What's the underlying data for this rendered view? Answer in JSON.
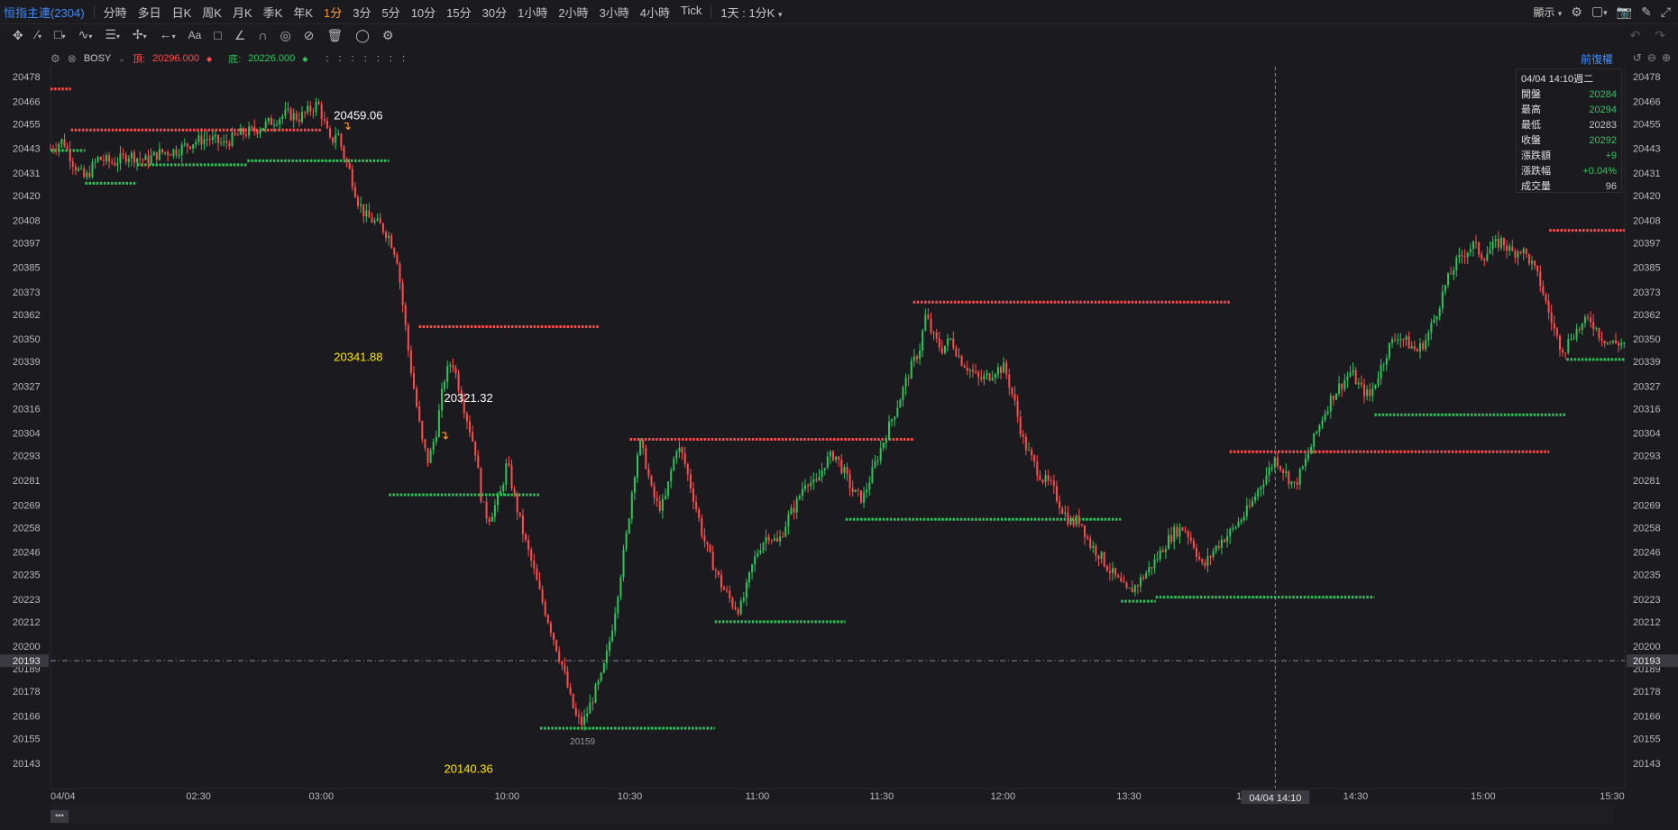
{
  "toolbar": {
    "symbol": "恒指主連(2304)",
    "timeframes": [
      "分時",
      "多日",
      "日K",
      "周K",
      "月K",
      "季K",
      "年K",
      "1分",
      "3分",
      "5分",
      "10分",
      "15分",
      "30分",
      "1小時",
      "2小時",
      "3小時",
      "4小時",
      "Tick"
    ],
    "active_timeframe": "1分",
    "interval_select": "1天 : 1分K",
    "display_label": "顯示",
    "icons": [
      "chevron-down-icon",
      "gear-icon",
      "window-icon",
      "camera-icon",
      "brush-icon",
      "expand-icon"
    ]
  },
  "drawbar": {
    "icons": [
      "crosshair-icon",
      "trendline-icon",
      "rectangle-icon",
      "polyline-icon",
      "fib-icon",
      "measure-icon",
      "arrow-icon",
      "text-icon",
      "comment-icon",
      "ruler-icon",
      "magnet-icon",
      "lock-icon",
      "hide-icon",
      "delete-icon",
      "link-icon",
      "settings-icon"
    ],
    "right_icons": [
      "undo-icon",
      "redo-icon"
    ]
  },
  "legend": {
    "name": "BOSY",
    "top_label": "頂:",
    "top_value": "20296.000",
    "bottom_label": "底:",
    "bottom_value": "20226.000",
    "placeholders": ":   :   :   :   :   :   :",
    "adjust_label": "前復權"
  },
  "infobox": {
    "datetime": "04/04 14:10週二",
    "rows": [
      {
        "label": "開盤",
        "value": "20284",
        "color": "up"
      },
      {
        "label": "最高",
        "value": "20294",
        "color": "up"
      },
      {
        "label": "最低",
        "value": "20283",
        "color": "neutral"
      },
      {
        "label": "收盤",
        "value": "20292",
        "color": "up"
      },
      {
        "label": "漲跌額",
        "value": "+9",
        "color": "up"
      },
      {
        "label": "漲跌幅",
        "value": "+0.04%",
        "color": "up"
      },
      {
        "label": "成交量",
        "value": "96",
        "color": "neutral"
      }
    ]
  },
  "colors": {
    "background": "#1b1b1f",
    "up": "#30c35a",
    "down": "#ff4d4d",
    "accent": "#3f8cff",
    "active": "#ff9a2e",
    "annotation": "#ffe600",
    "annotation_white": "#ffffff",
    "grid": "#28282c"
  },
  "chart_data": {
    "type": "candlestick",
    "symbol": "恒指主連(2304)",
    "interval": "1分",
    "y_axis_ticks": [
      20478,
      20466,
      20455,
      20443,
      20431,
      20420,
      20408,
      20397,
      20385,
      20373,
      20362,
      20350,
      20339,
      20327,
      20316,
      20304,
      20293,
      20281,
      20269,
      20258,
      20246,
      20235,
      20223,
      20212,
      20200,
      20189,
      20178,
      20166,
      20155,
      20143
    ],
    "y_range": [
      20135,
      20482
    ],
    "x_axis_labels": [
      "04/04",
      "02:30",
      "03:00",
      "10:00",
      "10:30",
      "11:00",
      "11:30",
      "12:00",
      "13:30",
      "1",
      "14:30",
      "15:00",
      "15:30"
    ],
    "x_range": [
      0,
      1000
    ],
    "x_axis_label_positions": [
      0,
      94,
      172,
      290,
      368,
      449,
      528,
      605,
      685,
      755,
      829,
      910,
      992
    ],
    "current_price": "20193",
    "crosshair_label": "04/04 14:10",
    "crosshair_x": 778,
    "price_path": [
      [
        0,
        20443
      ],
      [
        8,
        20447
      ],
      [
        15,
        20435
      ],
      [
        22,
        20428
      ],
      [
        30,
        20438
      ],
      [
        40,
        20436
      ],
      [
        50,
        20440
      ],
      [
        60,
        20437
      ],
      [
        70,
        20441
      ],
      [
        80,
        20442
      ],
      [
        90,
        20446
      ],
      [
        100,
        20448
      ],
      [
        110,
        20445
      ],
      [
        120,
        20450
      ],
      [
        130,
        20452
      ],
      [
        140,
        20456
      ],
      [
        150,
        20460
      ],
      [
        158,
        20458
      ],
      [
        165,
        20462
      ],
      [
        170,
        20465
      ],
      [
        174,
        20455
      ],
      [
        178,
        20445
      ],
      [
        182,
        20452
      ],
      [
        186,
        20440
      ],
      [
        190,
        20432
      ],
      [
        195,
        20418
      ],
      [
        200,
        20410
      ],
      [
        210,
        20405
      ],
      [
        215,
        20400
      ],
      [
        220,
        20390
      ],
      [
        224,
        20365
      ],
      [
        228,
        20340
      ],
      [
        232,
        20320
      ],
      [
        236,
        20300
      ],
      [
        240,
        20290
      ],
      [
        245,
        20305
      ],
      [
        250,
        20330
      ],
      [
        255,
        20340
      ],
      [
        260,
        20325
      ],
      [
        265,
        20310
      ],
      [
        270,
        20295
      ],
      [
        274,
        20270
      ],
      [
        278,
        20262
      ],
      [
        282,
        20268
      ],
      [
        286,
        20275
      ],
      [
        290,
        20290
      ],
      [
        294,
        20275
      ],
      [
        298,
        20262
      ],
      [
        302,
        20250
      ],
      [
        306,
        20240
      ],
      [
        310,
        20228
      ],
      [
        314,
        20218
      ],
      [
        318,
        20208
      ],
      [
        322,
        20198
      ],
      [
        326,
        20188
      ],
      [
        330,
        20175
      ],
      [
        334,
        20165
      ],
      [
        338,
        20162
      ],
      [
        342,
        20170
      ],
      [
        346,
        20178
      ],
      [
        350,
        20185
      ],
      [
        354,
        20198
      ],
      [
        358,
        20215
      ],
      [
        362,
        20235
      ],
      [
        366,
        20255
      ],
      [
        370,
        20280
      ],
      [
        374,
        20300
      ],
      [
        378,
        20290
      ],
      [
        382,
        20275
      ],
      [
        386,
        20268
      ],
      [
        390,
        20270
      ],
      [
        394,
        20285
      ],
      [
        398,
        20298
      ],
      [
        402,
        20292
      ],
      [
        406,
        20280
      ],
      [
        410,
        20268
      ],
      [
        414,
        20255
      ],
      [
        418,
        20245
      ],
      [
        422,
        20238
      ],
      [
        426,
        20230
      ],
      [
        430,
        20225
      ],
      [
        434,
        20220
      ],
      [
        438,
        20218
      ],
      [
        442,
        20228
      ],
      [
        446,
        20240
      ],
      [
        450,
        20248
      ],
      [
        456,
        20255
      ],
      [
        462,
        20250
      ],
      [
        468,
        20262
      ],
      [
        474,
        20270
      ],
      [
        480,
        20282
      ],
      [
        486,
        20278
      ],
      [
        492,
        20290
      ],
      [
        498,
        20294
      ],
      [
        504,
        20285
      ],
      [
        510,
        20275
      ],
      [
        516,
        20272
      ],
      [
        522,
        20285
      ],
      [
        528,
        20298
      ],
      [
        534,
        20310
      ],
      [
        540,
        20322
      ],
      [
        546,
        20335
      ],
      [
        552,
        20345
      ],
      [
        556,
        20362
      ],
      [
        560,
        20352
      ],
      [
        566,
        20345
      ],
      [
        572,
        20350
      ],
      [
        578,
        20340
      ],
      [
        584,
        20335
      ],
      [
        590,
        20330
      ],
      [
        596,
        20332
      ],
      [
        600,
        20335
      ],
      [
        606,
        20336
      ],
      [
        612,
        20320
      ],
      [
        618,
        20300
      ],
      [
        624,
        20290
      ],
      [
        630,
        20282
      ],
      [
        636,
        20278
      ],
      [
        642,
        20268
      ],
      [
        648,
        20260
      ],
      [
        654,
        20262
      ],
      [
        660,
        20250
      ],
      [
        666,
        20245
      ],
      [
        672,
        20238
      ],
      [
        678,
        20232
      ],
      [
        684,
        20226
      ],
      [
        690,
        20230
      ],
      [
        696,
        20236
      ],
      [
        702,
        20242
      ],
      [
        708,
        20250
      ],
      [
        714,
        20256
      ],
      [
        720,
        20258
      ],
      [
        726,
        20250
      ],
      [
        732,
        20238
      ],
      [
        738,
        20246
      ],
      [
        744,
        20252
      ],
      [
        750,
        20256
      ],
      [
        756,
        20262
      ],
      [
        762,
        20268
      ],
      [
        768,
        20278
      ],
      [
        774,
        20286
      ],
      [
        778,
        20292
      ],
      [
        784,
        20285
      ],
      [
        790,
        20278
      ],
      [
        796,
        20288
      ],
      [
        802,
        20300
      ],
      [
        808,
        20312
      ],
      [
        814,
        20322
      ],
      [
        820,
        20328
      ],
      [
        826,
        20334
      ],
      [
        832,
        20326
      ],
      [
        838,
        20322
      ],
      [
        844,
        20334
      ],
      [
        850,
        20346
      ],
      [
        856,
        20352
      ],
      [
        862,
        20348
      ],
      [
        868,
        20344
      ],
      [
        874,
        20350
      ],
      [
        880,
        20362
      ],
      [
        886,
        20376
      ],
      [
        892,
        20386
      ],
      [
        898,
        20392
      ],
      [
        904,
        20396
      ],
      [
        910,
        20390
      ],
      [
        916,
        20395
      ],
      [
        922,
        20398
      ],
      [
        928,
        20392
      ],
      [
        934,
        20394
      ],
      [
        940,
        20388
      ],
      [
        946,
        20378
      ],
      [
        952,
        20362
      ],
      [
        958,
        20348
      ],
      [
        962,
        20345
      ],
      [
        966,
        20352
      ],
      [
        972,
        20356
      ],
      [
        978,
        20360
      ],
      [
        984,
        20352
      ],
      [
        990,
        20348
      ]
    ],
    "bosy_top_levels": [
      {
        "x0": 0,
        "x1": 13,
        "y": 20472
      },
      {
        "x0": 13,
        "x1": 172,
        "y": 20452
      },
      {
        "x0": 234,
        "x1": 349,
        "y": 20356
      },
      {
        "x0": 368,
        "x1": 548,
        "y": 20301
      },
      {
        "x0": 548,
        "x1": 749,
        "y": 20368
      },
      {
        "x0": 749,
        "x1": 952,
        "y": 20295
      },
      {
        "x0": 952,
        "x1": 1000,
        "y": 20403
      }
    ],
    "bosy_bottom_levels": [
      {
        "x0": 0,
        "x1": 22,
        "y": 20442
      },
      {
        "x0": 22,
        "x1": 55,
        "y": 20426
      },
      {
        "x0": 55,
        "x1": 125,
        "y": 20435
      },
      {
        "x0": 125,
        "x1": 215,
        "y": 20437
      },
      {
        "x0": 215,
        "x1": 311,
        "y": 20274
      },
      {
        "x0": 311,
        "x1": 422,
        "y": 20160
      },
      {
        "x0": 422,
        "x1": 505,
        "y": 20212
      },
      {
        "x0": 505,
        "x1": 680,
        "y": 20262
      },
      {
        "x0": 680,
        "x1": 702,
        "y": 20222
      },
      {
        "x0": 702,
        "x1": 841,
        "y": 20224
      },
      {
        "x0": 841,
        "x1": 963,
        "y": 20313
      },
      {
        "x0": 963,
        "x1": 1000,
        "y": 20340
      }
    ],
    "annotations": [
      {
        "text": "20459.06",
        "x": 180,
        "y": 20459,
        "color": "white"
      },
      {
        "text": "20341.88",
        "x": 180,
        "y": 20341,
        "color": "yellow"
      },
      {
        "text": "20321.32",
        "x": 250,
        "y": 20321,
        "color": "white"
      },
      {
        "text": "20140.36",
        "x": 250,
        "y": 20140,
        "color": "yellow"
      },
      {
        "text": "20159",
        "x": 330,
        "y": 20154,
        "color": "gray"
      }
    ]
  }
}
